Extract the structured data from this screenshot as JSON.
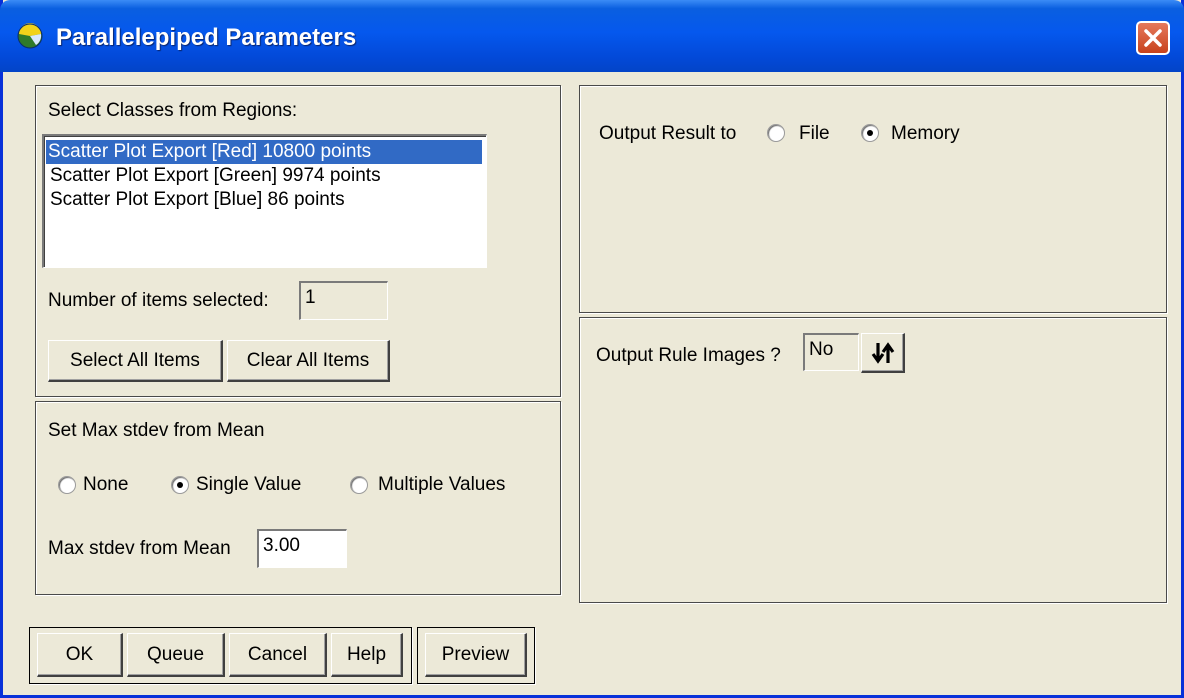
{
  "window": {
    "title": "Parallelepiped Parameters"
  },
  "classes": {
    "label": "Select Classes from Regions:",
    "items": [
      "Scatter Plot Export [Red] 10800 points",
      "Scatter Plot Export [Green] 9974 points",
      "Scatter Plot Export [Blue] 86 points"
    ],
    "selected_index": 0,
    "count_label": "Number of items selected:",
    "count_value": "1",
    "select_all_label": "Select All Items",
    "clear_all_label": "Clear All Items"
  },
  "stdev": {
    "label": "Set Max stdev from Mean",
    "options": [
      "None",
      "Single Value",
      "Multiple Values"
    ],
    "selected": "Single Value",
    "value_label": "Max stdev from Mean",
    "value": "3.00"
  },
  "output": {
    "label": "Output Result to",
    "options": [
      "File",
      "Memory"
    ],
    "selected": "Memory"
  },
  "rule_images": {
    "label": "Output Rule Images ?",
    "value": "No",
    "toggle_icon": "up-down-arrows-icon"
  },
  "buttons": {
    "ok": "OK",
    "queue": "Queue",
    "cancel": "Cancel",
    "help": "Help",
    "preview": "Preview"
  },
  "colors": {
    "titlebar": "#0558ee",
    "selection": "#316ac5",
    "dialog_bg": "#ece9d8"
  }
}
